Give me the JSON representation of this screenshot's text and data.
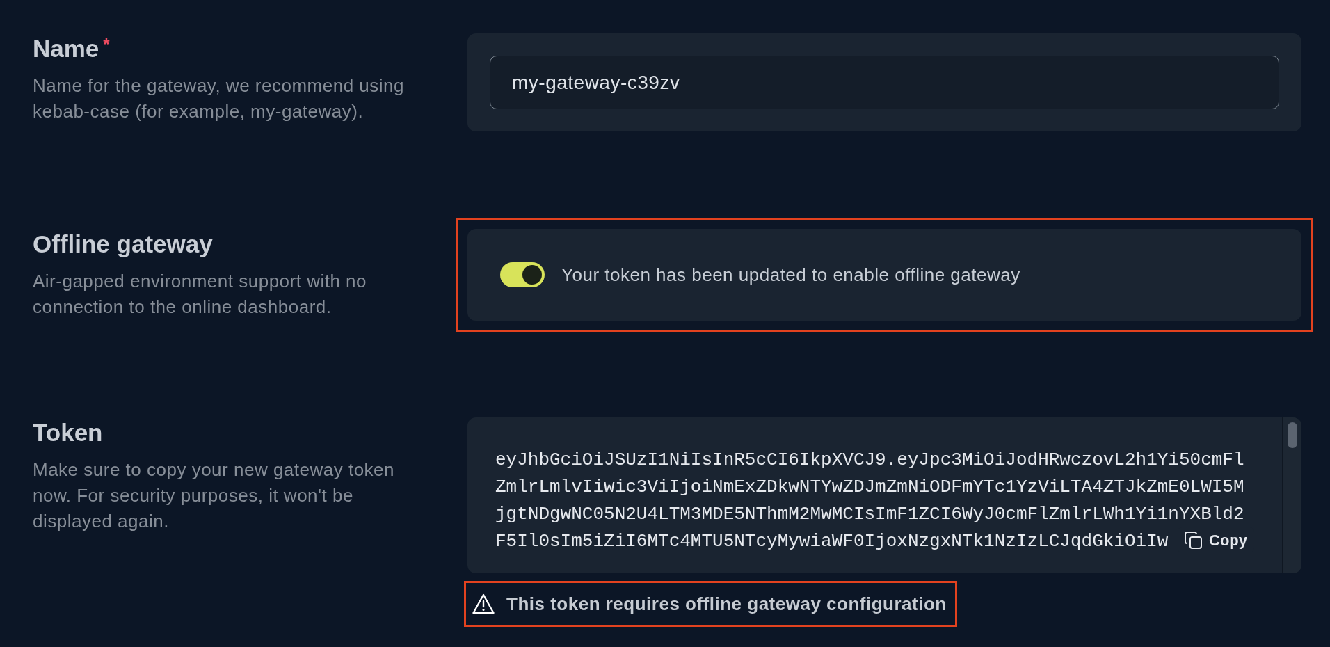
{
  "name": {
    "title": "Name",
    "required_mark": "*",
    "description": "Name for the gateway, we recommend using kebab-case (for example, my-gateway).",
    "input": {
      "value": "my-gateway-c39zv"
    }
  },
  "offline_gateway": {
    "title": "Offline gateway",
    "description": "Air-gapped environment support with no connection to the online dashboard.",
    "highlighted": true,
    "toggle": {
      "on": true,
      "label": "Your token has been updated to enable offline gateway"
    }
  },
  "token": {
    "title": "Token",
    "description": "Make sure to copy your new gateway token now. For security purposes, it won't be displayed again.",
    "lines": [
      "eyJhbGciOiJSUzI1NiIsInR5cCI6IkpXVCJ9.eyJpc3MiOiJodHRwczovL2h1Yi50cmFl",
      "ZmlrLmlvIiwic3ViIjoiNmExZDkwNTYwZDJmZmNiODFmYTc1YzViLTA4ZTJkZmE0LWI5M",
      "jgtNDgwNC05N2U4LTM3MDE5NThmM2MwMCIsImF1ZCI6WyJ0cmFlZmlrLWh1Yi1nYXBld2",
      "F5Il0sIm5iZiI6MTc4MTU5NTcyMywiaWF0IjoxNzgxNTk1NzIzLCJqdGkiOiIw"
    ],
    "copy_label": "Copy",
    "warning": {
      "text": "This token requires offline gateway configuration",
      "highlighted": true
    }
  }
}
